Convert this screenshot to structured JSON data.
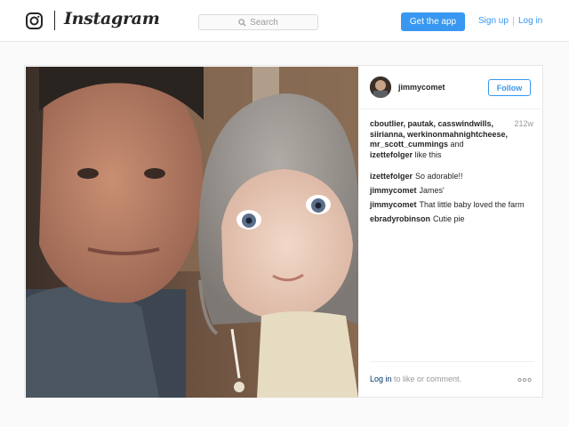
{
  "header": {
    "brand": "Instagram",
    "search_placeholder": "Search",
    "get_app_label": "Get the app",
    "signup_label": "Sign up",
    "login_label": "Log in",
    "accent_color": "#3897f0"
  },
  "post": {
    "username": "jimmycomet",
    "follow_label": "Follow",
    "time_ago": "212w",
    "likes": {
      "line1": "cboutlier, pautak, casswindwills,",
      "line2": "siirianna, werkinonmahnightcheese,",
      "line3": "mr_scott_cummings",
      "line3_and": " and",
      "line4": "izettefolger",
      "line4_suffix": " like this"
    },
    "comments": [
      {
        "user": "izettefolger",
        "text": "So adorable!!"
      },
      {
        "user": "jimmycomet",
        "text": "James'"
      },
      {
        "user": "jimmycomet",
        "text": "That little baby loved the farm"
      },
      {
        "user": "ebradyrobinson",
        "text": "Cutie pie"
      }
    ],
    "footer": {
      "login_link": "Log in",
      "login_rest": " to like or comment."
    },
    "icons": {
      "photo": "photo-of-man-and-baby",
      "more": "more-options-icon"
    }
  }
}
